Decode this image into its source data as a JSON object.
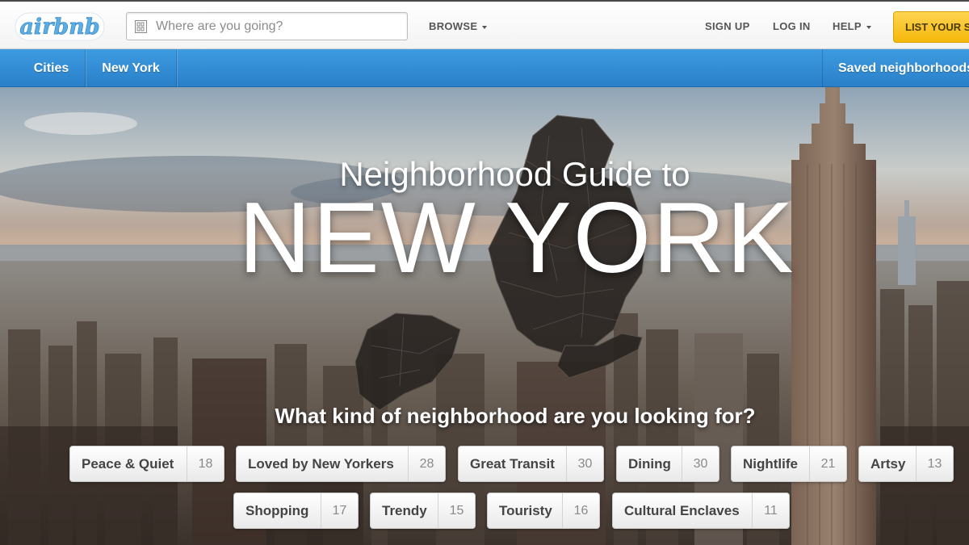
{
  "header": {
    "logo_text": "airbnb",
    "search": {
      "placeholder": "Where are you going?",
      "value": ""
    },
    "nav": {
      "browse": "BROWSE",
      "sign_up": "SIGN UP",
      "log_in": "LOG IN",
      "help": "HELP"
    },
    "list_button": "LIST YOUR S"
  },
  "subnav": {
    "crumbs": [
      "Cities",
      "New York"
    ],
    "saved": "Saved neighborhoods"
  },
  "hero": {
    "subtitle": "Neighborhood Guide to",
    "title": "NEW YORK",
    "question": "What kind of neighborhood are you looking for?"
  },
  "filters": [
    {
      "label": "Peace & Quiet",
      "count": "18"
    },
    {
      "label": "Loved by New Yorkers",
      "count": "28"
    },
    {
      "label": "Great Transit",
      "count": "30"
    },
    {
      "label": "Dining",
      "count": "30"
    },
    {
      "label": "Nightlife",
      "count": "21"
    },
    {
      "label": "Artsy",
      "count": "13"
    },
    {
      "label": "Shopping",
      "count": "17"
    },
    {
      "label": "Trendy",
      "count": "15"
    },
    {
      "label": "Touristy",
      "count": "16"
    },
    {
      "label": "Cultural Enclaves",
      "count": "11"
    }
  ],
  "colors": {
    "brand_blue": "#2f8ad6",
    "list_yellow": "#f7c21b",
    "logo_blue": "#57a9e0"
  },
  "icons": {
    "search": "search-icon",
    "browse_caret": "chevron-down-icon",
    "help_caret": "chevron-down-icon"
  }
}
